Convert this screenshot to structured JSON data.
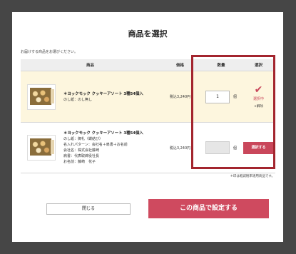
{
  "modal": {
    "title": "商品を選択",
    "instruction": "お届けする商品をお選びください。",
    "note": "＊印は軽減税率適用商品です。",
    "close_label": "閉じる",
    "set_label": "この商品で設定する"
  },
  "table": {
    "headers": {
      "product": "商品",
      "price": "価格",
      "quantity": "数量",
      "select": "選択"
    },
    "rows": [
      {
        "name": "＊ヨックモック クッキーアソート 3種54個入",
        "details": [
          "のし紙：のし無し"
        ],
        "price": "税込3,240円",
        "quantity": "1",
        "unit": "個",
        "selected_label": "選択中",
        "remove_label": "×解除"
      },
      {
        "name": "＊ヨックモック クッキーアソート 3種54個入",
        "details": [
          "のし紙：御礼（蝶結び）",
          "名入れパターン：会社名＋肩書＋お名前",
          "会社名：株式会社藤崎",
          "肩書：代表取締役社長",
          "お名前：藤崎　花子"
        ],
        "price": "税込3,240円",
        "quantity": "",
        "unit": "個",
        "select_label": "選択する"
      }
    ]
  },
  "colors": {
    "accent": "#cf4a5f",
    "highlight_border": "#a3252e",
    "selected_row_bg": "#fdf6de",
    "overlay_bg": "#464646"
  },
  "icons": {
    "selected": "checkmark-icon"
  }
}
